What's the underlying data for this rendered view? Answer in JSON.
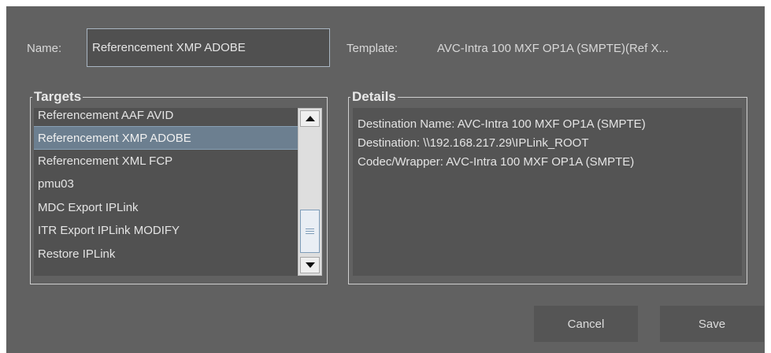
{
  "form": {
    "name_label": "Name:",
    "name_value": "Referencement XMP ADOBE",
    "template_label": "Template:",
    "template_value": "AVC-Intra 100 MXF OP1A (SMPTE)(Ref X..."
  },
  "targets": {
    "legend": "Targets",
    "items": [
      "Referencement AAF AVID",
      "Referencement XMP ADOBE",
      "Referencement XML FCP",
      "pmu03",
      "MDC Export IPLink",
      "ITR Export IPLink MODIFY",
      "Restore IPLink"
    ],
    "selected_index": 1
  },
  "details": {
    "legend": "Details",
    "lines": [
      "Destination Name: AVC-Intra 100 MXF OP1A (SMPTE)",
      "Destination: \\\\192.168.217.29\\IPLink_ROOT",
      "Codec/Wrapper: AVC-Intra 100 MXF OP1A (SMPTE)"
    ]
  },
  "buttons": {
    "cancel": "Cancel",
    "save": "Save"
  },
  "icons": {
    "scroll_up": "scroll-up-arrow-icon",
    "scroll_down": "scroll-down-arrow-icon",
    "scroll_grip": "scrollbar-grip-icon"
  },
  "colors": {
    "dialog_bg": "#616161",
    "selection_bg": "#6c7f90",
    "input_border": "#a9b6c2"
  }
}
